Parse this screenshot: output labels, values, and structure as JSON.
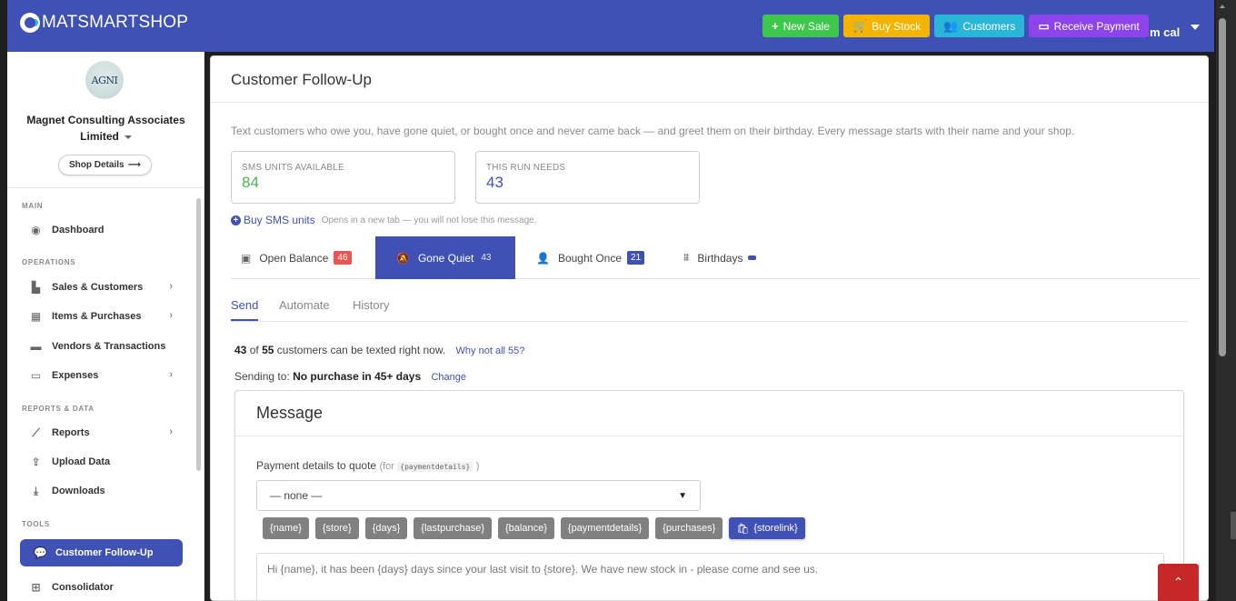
{
  "brand": {
    "name": "MATSMARTSHOP"
  },
  "topbar": {
    "actions": [
      {
        "label": "New Sale",
        "icon": "plus-icon",
        "color": "#3ec74a"
      },
      {
        "label": "Buy Stock",
        "icon": "cart-icon",
        "color": "#f5b400"
      },
      {
        "label": "Customers",
        "icon": "users-icon",
        "color": "#29b6d8"
      },
      {
        "label": "Receive Payment",
        "icon": "card-icon",
        "color": "#8e44ec"
      }
    ],
    "user": "m cal"
  },
  "sidebar": {
    "shop_logo_text": "AGNI",
    "shop_name": "Magnet Consulting Associates Limited",
    "shop_details_label": "Shop Details",
    "sections": [
      {
        "title": "MAIN",
        "items": [
          {
            "label": "Dashboard",
            "icon": "dashboard-icon"
          }
        ]
      },
      {
        "title": "OPERATIONS",
        "items": [
          {
            "label": "Sales & Customers",
            "icon": "bag-icon",
            "has_submenu": true
          },
          {
            "label": "Items & Purchases",
            "icon": "boxes-icon",
            "has_submenu": true
          },
          {
            "label": "Vendors & Transactions",
            "icon": "truck-icon",
            "has_submenu": false
          },
          {
            "label": "Expenses",
            "icon": "card-icon",
            "has_submenu": true
          }
        ]
      },
      {
        "title": "REPORTS & DATA",
        "items": [
          {
            "label": "Reports",
            "icon": "chart-icon",
            "has_submenu": true
          },
          {
            "label": "Upload Data",
            "icon": "upload-icon",
            "has_submenu": false
          },
          {
            "label": "Downloads",
            "icon": "download-icon",
            "has_submenu": false
          }
        ]
      },
      {
        "title": "TOOLS",
        "items": [
          {
            "label": "Customer Follow-Up",
            "icon": "chat-icon",
            "active": true
          },
          {
            "label": "Consolidator",
            "icon": "sitemap-icon"
          }
        ]
      }
    ]
  },
  "main": {
    "title": "Customer Follow-Up",
    "intro": "Text customers who owe you, have gone quiet, or bought once and never came back — and greet them on their birthday. Every message starts with their name and your shop.",
    "stats": [
      {
        "label": "SMS UNITS AVAILABLE",
        "value": "84",
        "color": "#4caf50"
      },
      {
        "label": "THIS RUN NEEDS",
        "value": "43",
        "color": "#3f51b5"
      }
    ],
    "buy_sms": {
      "label": "Buy SMS units",
      "note": "Opens in a new tab — you will not lose this message."
    },
    "segments": [
      {
        "label": "Open Balance",
        "count": "46",
        "badge_color": "#ef5350",
        "icon": "money-icon"
      },
      {
        "label": "Gone Quiet",
        "count": "43",
        "active": true,
        "icon": "bell-slash-icon"
      },
      {
        "label": "Bought Once",
        "count": "21",
        "badge_color": "#3f51b5",
        "icon": "user-plus-icon"
      },
      {
        "label": "Birthdays",
        "count": "",
        "badge_color": "#3f51b5",
        "icon": "cake-icon"
      }
    ],
    "subtabs": [
      "Send",
      "Automate",
      "History"
    ],
    "count_line": {
      "reachable": "43",
      "of": "of",
      "total": "55",
      "suffix": "customers can be texted right now.",
      "link": "Why not all 55?"
    },
    "send_line": {
      "prefix": "Sending to:",
      "target": "No purchase in 45+ days",
      "link": "Change"
    },
    "message": {
      "title": "Message",
      "payment_label": "Payment details to quote",
      "payment_hint_prefix": "(for",
      "payment_hint_code": "{paymentdetails}",
      "payment_hint_suffix": ")",
      "select_value": "— none —",
      "placeholders": [
        "{name}",
        "{store}",
        "{days}",
        "{lastpurchase}",
        "{balance}",
        "{paymentdetails}",
        "{purchases}"
      ],
      "storelink_label": "{storelink}",
      "body": "Hi {name}, it has been {days} days since your last visit to {store}. We have new stock in - please come and see us."
    }
  }
}
